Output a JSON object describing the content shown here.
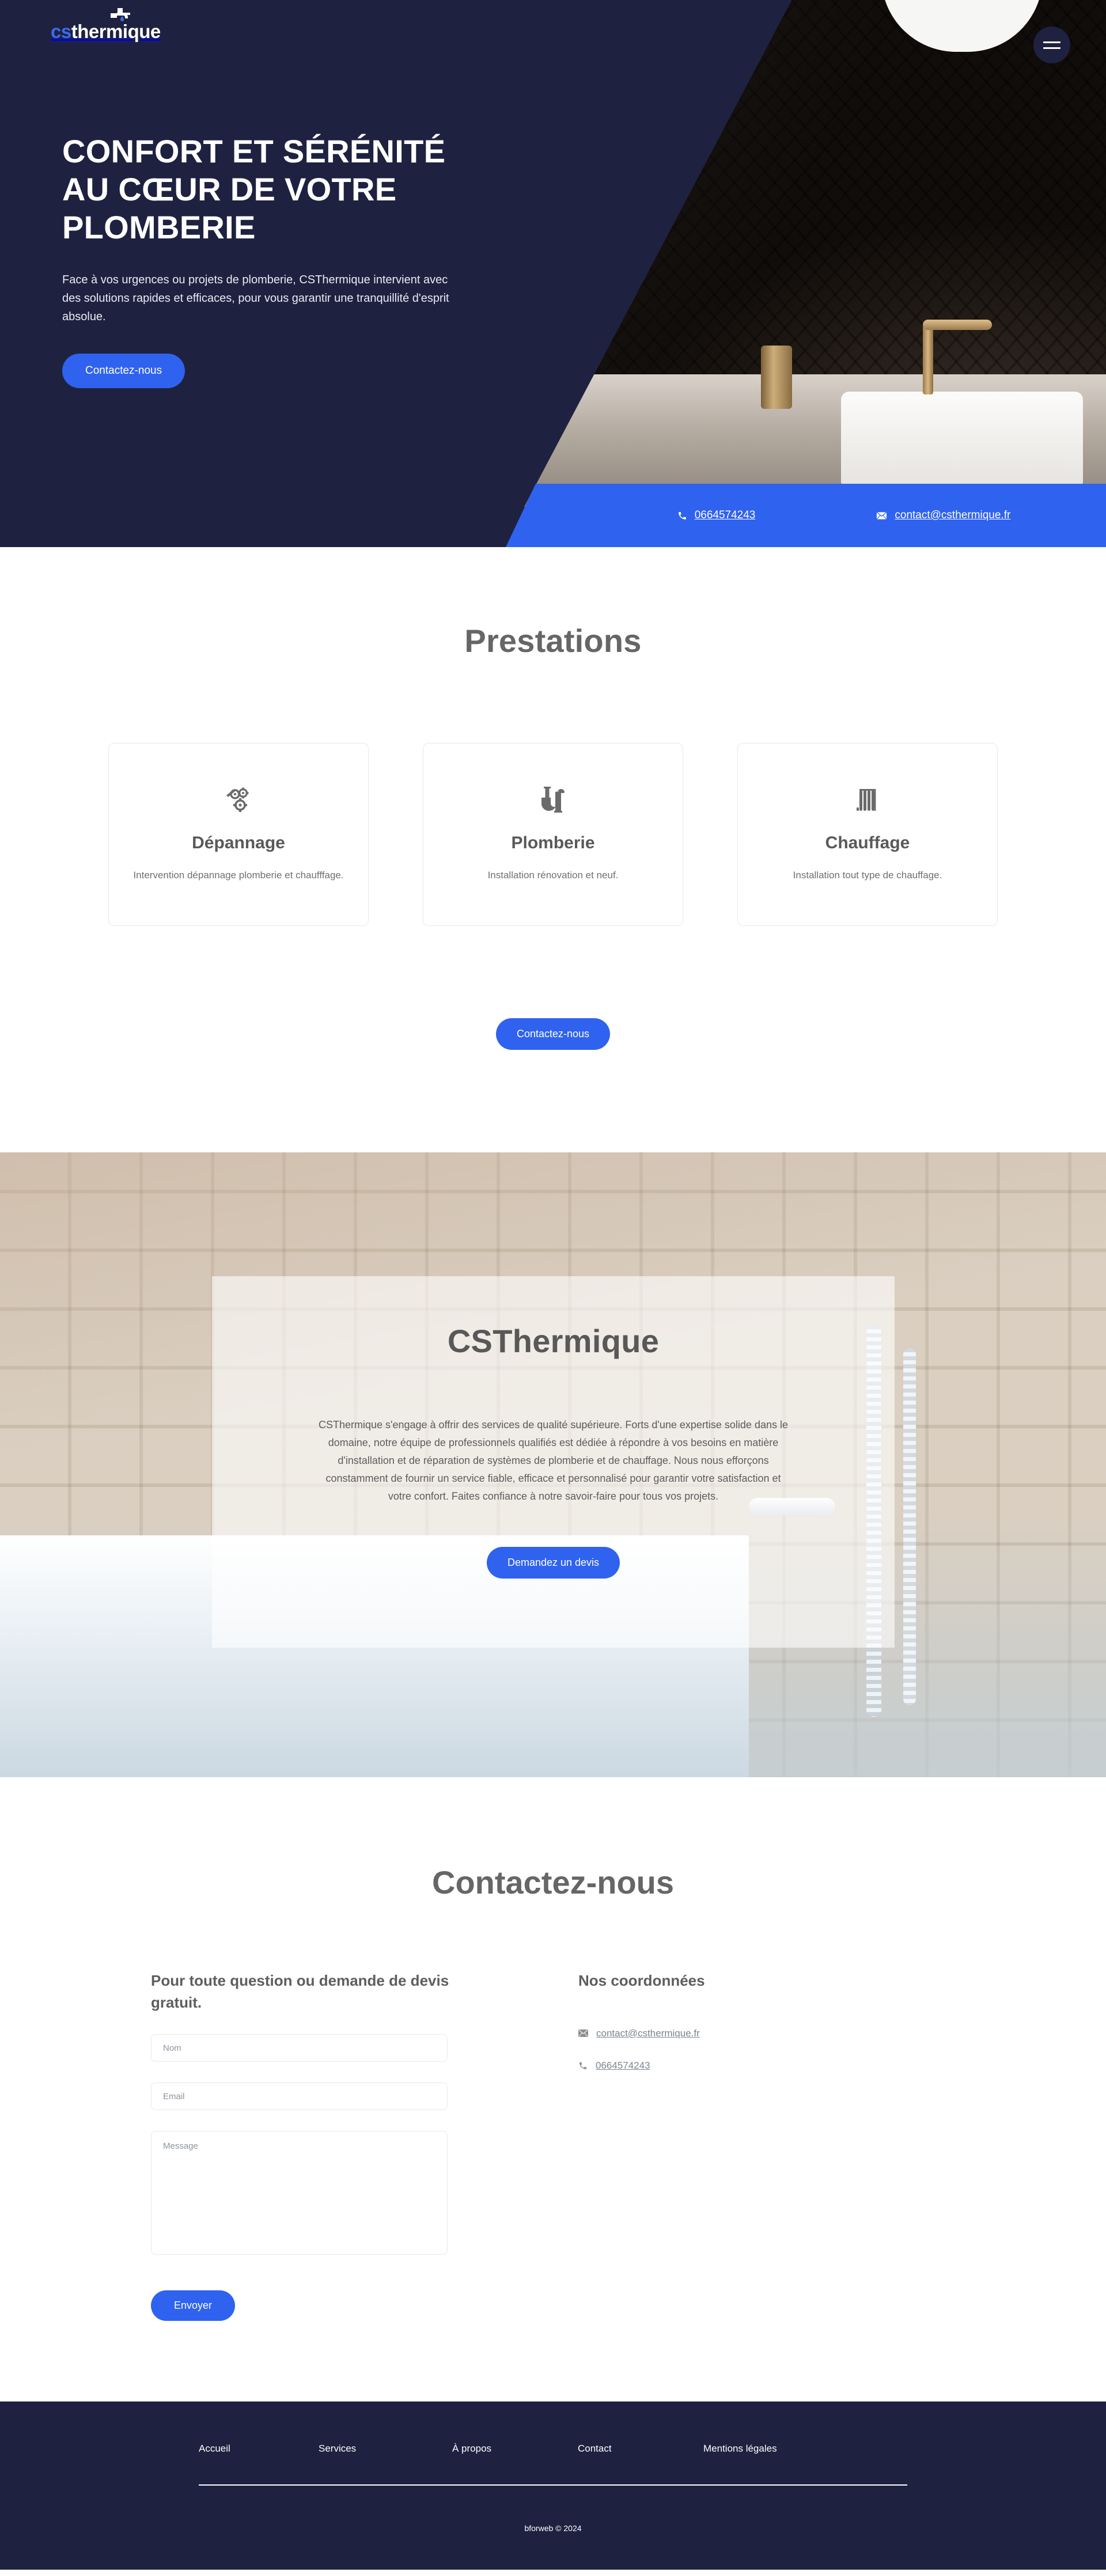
{
  "brand": {
    "logo_cs": "cs",
    "logo_thermique": "thermique",
    "accent_blue": "#2f62ef",
    "navy": "#1e2240",
    "grey_text": "#666666"
  },
  "header": {
    "menu_label": "menu"
  },
  "hero": {
    "title": "CONFORT ET SÉRÉNITÉ AU CŒUR DE VOTRE PLOMBERIE",
    "subtitle": "Face à vos urgences ou projets de plomberie, CSThermique intervient avec des solutions rapides et efficaces, pour vous garantir une tranquillité d'esprit absolue.",
    "cta": "Contactez-nous",
    "contact_bar": {
      "phone": "0664574243",
      "email": "contact@csthermique.fr"
    }
  },
  "prestations": {
    "title": "Prestations",
    "cards": [
      {
        "icon": "gears-repair-icon",
        "title": "Dépannage",
        "desc": "Intervention dépannage plomberie et chaufffage."
      },
      {
        "icon": "pipe-siphon-icon",
        "title": "Plomberie",
        "desc": "Installation rénovation et neuf."
      },
      {
        "icon": "radiator-icon",
        "title": "Chauffage",
        "desc": "Installation tout type de chauffage."
      }
    ],
    "cta": "Contactez-nous"
  },
  "about": {
    "title": "CSThermique",
    "text": "CSThermique s'engage à offrir des services de qualité supérieure. Forts d'une expertise solide dans le domaine, notre équipe de professionnels qualifiés est dédiée à répondre à vos besoins en matière d'installation et de réparation de systèmes de plomberie et de chauffage. Nous nous efforçons constamment de fournir un service fiable, efficace et personnalisé pour garantir votre satisfaction et votre confort. Faites confiance à notre savoir-faire pour tous vos projets.",
    "cta": "Demandez un devis"
  },
  "contact": {
    "title": "Contactez-nous",
    "form_heading": "Pour toute question ou demande de devis gratuit.",
    "fields": {
      "name_placeholder": "Nom",
      "name_value": "",
      "email_placeholder": "Email",
      "email_value": "",
      "message_placeholder": "Message",
      "message_value": ""
    },
    "submit": "Envoyer",
    "coordinates_heading": "Nos coordonnées",
    "email": "contact@csthermique.fr",
    "phone": "0664574243"
  },
  "footer": {
    "links": [
      "Accueil",
      "Services",
      "À propos",
      "Contact",
      "Mentions légales"
    ],
    "copyright": "bforweb © 2024"
  }
}
